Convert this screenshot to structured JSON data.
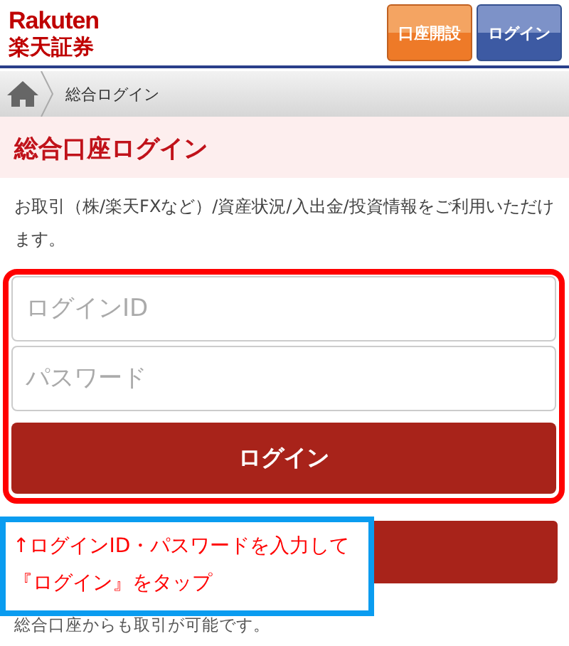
{
  "header": {
    "logo_top": "Rakuten",
    "logo_bottom": "楽天証券",
    "buttons": [
      {
        "label": "口座開設",
        "kind": "open"
      },
      {
        "label": "ログイン",
        "kind": "login"
      }
    ]
  },
  "breadcrumb": {
    "current": "総合ログイン"
  },
  "title": "総合口座ログイン",
  "description": "お取引（株/楽天FXなど）/資産状況/入出金/投資情報をご利用いただけます。",
  "form": {
    "fields": [
      {
        "placeholder": "ログインID"
      },
      {
        "placeholder": "パスワード"
      }
    ],
    "submit": "ログイン"
  },
  "callout": {
    "lines": [
      "↑ログインID・パスワードを入力して",
      "『ログイン』をタップ"
    ]
  },
  "footer_note": "総合口座からも取引が可能です。"
}
